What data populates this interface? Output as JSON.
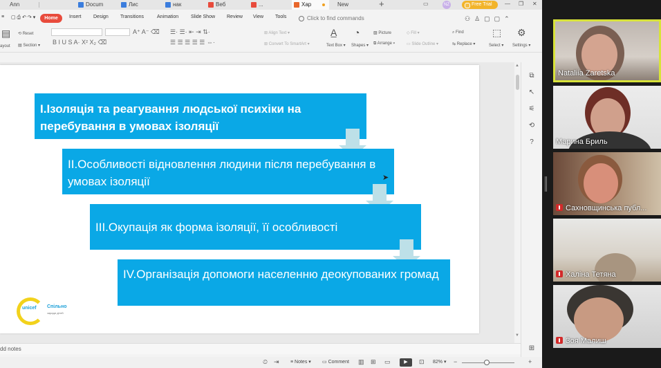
{
  "tabs": [
    {
      "label": "Ann"
    },
    {
      "label": "Docum"
    },
    {
      "label": "Лис"
    },
    {
      "label": "нак"
    },
    {
      "label": "Веб"
    },
    {
      "label": "..."
    },
    {
      "label": "Хар"
    },
    {
      "label": "New"
    }
  ],
  "free_trial": "Free Trial",
  "avatar_initials": "NZ",
  "menu": {
    "home": "Home",
    "items": [
      "Insert",
      "Design",
      "Transitions",
      "Animation",
      "Slide Show",
      "Review",
      "View",
      "Tools"
    ],
    "search_placeholder": "Click to find commands"
  },
  "ribbon": {
    "reset": "Reset",
    "section": "Section",
    "layout": "ayout",
    "align_text": "Align Text",
    "convert_smartart": "Convert To SmartArt",
    "text_box": "Text Box",
    "shapes": "Shapes",
    "picture": "Picture",
    "arrange": "Arrange",
    "fill": "Fill",
    "slide_outline": "Slide Outline",
    "find": "Find",
    "replace": "Replace",
    "select": "Select",
    "settings": "Settings"
  },
  "slide": {
    "boxes": [
      {
        "text": "I.Ізоляція та реагування людської психіки на перебування в умовах ізоляції"
      },
      {
        "text": "II.Особливості відновлення людини після перебування в умовах ізоляції"
      },
      {
        "text": "III.Окупація як форма ізоляції, її особливості"
      },
      {
        "text": "IV.Організація допомоги населенню деокупованих громад"
      }
    ],
    "logo": {
      "brand": "unicef",
      "name": "Спільно",
      "tagline": "заради дітей"
    }
  },
  "notes_placeholder": "dd notes",
  "status": {
    "notes": "Notes",
    "comment": "Comment",
    "zoom": "82%"
  },
  "participants": [
    {
      "name": "Nataliia Zaretska",
      "muted": false,
      "active": true
    },
    {
      "name": "Марина Бриль",
      "muted": false,
      "active": false
    },
    {
      "name": "Сахновщинська публ...",
      "muted": true,
      "active": false
    },
    {
      "name": "Халіна Тетяна",
      "muted": true,
      "active": false
    },
    {
      "name": "Зоя Малиш",
      "muted": true,
      "active": false
    }
  ],
  "colors": {
    "box_blue": "#0aa8e6",
    "arrow": "#bde0e8",
    "home_red": "#e84b3c",
    "active_speaker": "#d8e33a",
    "trial": "#f2b42a"
  }
}
